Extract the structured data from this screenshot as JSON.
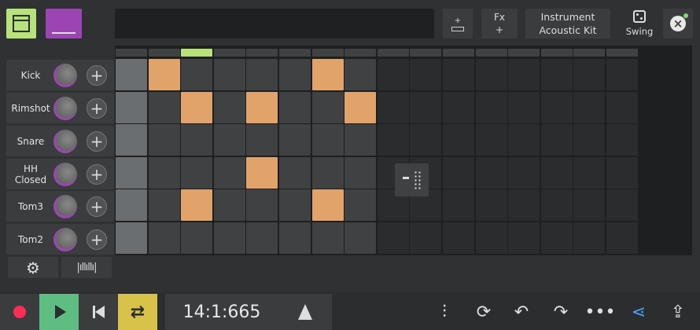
{
  "toolbar": {
    "fx_label": "Fx",
    "fx_sub": "+",
    "instrument_label": "Instrument",
    "instrument_value": "Acoustic Kit",
    "swing_label": "Swing",
    "add_bar_sub": "+",
    "accent_color": "#9d44b5",
    "active_color": "#b8e27a"
  },
  "tracks": [
    {
      "name": "Kick"
    },
    {
      "name": "Rimshot"
    },
    {
      "name": "Snare"
    },
    {
      "name": "HH Closed"
    },
    {
      "name": "Tom3"
    },
    {
      "name": "Tom2"
    }
  ],
  "sequencer": {
    "step_count": 16,
    "active_step": 3,
    "loop_length": 8,
    "note_color": "#e2a36b",
    "pattern": [
      [
        0,
        1,
        0,
        0,
        0,
        0,
        1,
        0,
        0,
        0,
        0,
        0,
        0,
        0,
        0,
        0
      ],
      [
        0,
        0,
        1,
        0,
        1,
        0,
        0,
        1,
        0,
        0,
        0,
        0,
        0,
        0,
        0,
        0
      ],
      [
        0,
        0,
        0,
        0,
        0,
        0,
        0,
        0,
        0,
        0,
        0,
        0,
        0,
        0,
        0,
        0
      ],
      [
        0,
        0,
        0,
        0,
        1,
        0,
        0,
        0,
        0,
        0,
        0,
        0,
        0,
        0,
        0,
        0
      ],
      [
        0,
        0,
        1,
        0,
        0,
        0,
        1,
        0,
        0,
        0,
        0,
        0,
        0,
        0,
        0,
        0
      ],
      [
        0,
        0,
        0,
        0,
        0,
        0,
        0,
        0,
        0,
        0,
        0,
        0,
        0,
        0,
        0,
        0
      ]
    ]
  },
  "transport": {
    "position": "14:1:665",
    "record_color": "#ff2d55",
    "play_color": "#5fbd82",
    "loop_color": "#d8c24a"
  },
  "icons": {
    "settings": "gear-icon",
    "waveform": "waveform-icon",
    "mixer": "mixer-sliders-icon",
    "sync": "sync-icon",
    "undo": "undo-icon",
    "redo": "redo-icon",
    "more": "more-icon",
    "share": "share-icon",
    "export": "export-icon"
  }
}
